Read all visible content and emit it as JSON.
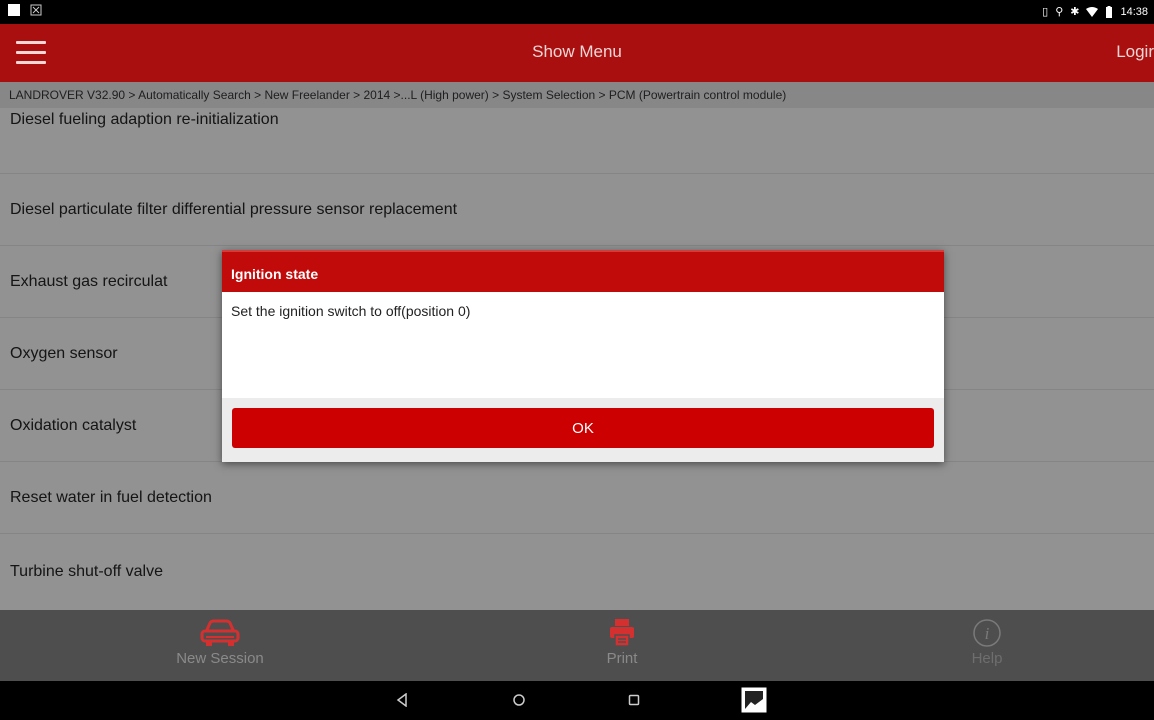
{
  "status_bar": {
    "time": "14:38",
    "left_icons": [
      "notification-square-icon",
      "screenshot-icon"
    ],
    "right_icons": [
      "vibrate-icon",
      "location-icon",
      "bluetooth-icon",
      "wifi-icon",
      "battery-icon"
    ]
  },
  "app_bar": {
    "menu_icon": "hamburger-menu-icon",
    "title": "Show Menu",
    "login_label": "Logir"
  },
  "breadcrumb": "LANDROVER V32.90 > Automatically Search > New Freelander > 2014 >...L (High power) > System Selection > PCM (Powertrain control module)",
  "list": {
    "items": [
      {
        "label": "Diesel fueling adaption re-initialization"
      },
      {
        "label": "Diesel particulate filter differential pressure sensor replacement"
      },
      {
        "label": "Exhaust gas recirculat"
      },
      {
        "label": "Oxygen sensor"
      },
      {
        "label": "Oxidation catalyst"
      },
      {
        "label": "Reset water in fuel detection"
      },
      {
        "label": "Turbine shut-off valve"
      }
    ]
  },
  "dialog": {
    "title": "Ignition state",
    "message": "Set the ignition switch to off(position 0)",
    "ok_label": "OK"
  },
  "toolbar": {
    "new_session": {
      "label": "New Session",
      "icon": "car-icon"
    },
    "print": {
      "label": "Print",
      "icon": "printer-icon"
    },
    "help": {
      "label": "Help",
      "icon": "info-icon"
    }
  },
  "nav_bar": {
    "back_icon": "back-triangle-icon",
    "home_icon": "home-circle-icon",
    "recents_icon": "recents-square-icon",
    "gallery_icon": "gallery-image-icon"
  },
  "colors": {
    "brand_red": "#a90f0f",
    "dialog_red": "#c10a0a",
    "ok_button_red": "#cc0000",
    "toolbar_gray": "#4e4e4e"
  }
}
